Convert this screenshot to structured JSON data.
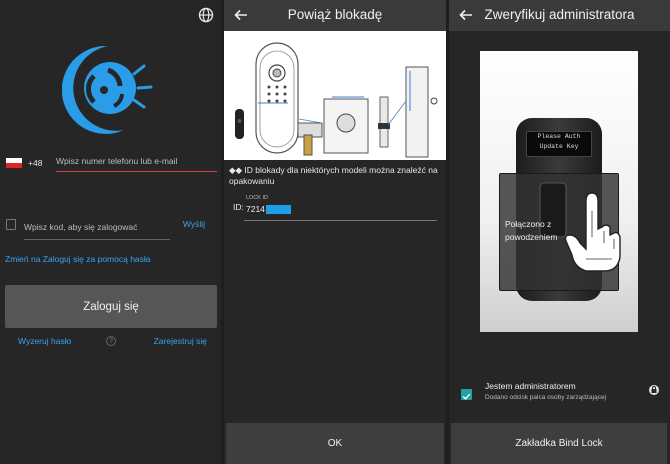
{
  "login": {
    "country_code": "+48",
    "phone_placeholder": "Wpisz numer telefonu lub e-mail",
    "code_placeholder": "Wpisz kod, aby się zalogować",
    "send_label": "Wyślij",
    "switch_label": "Zmień na Zaloguj się za pomocą hasła",
    "login_button": "Zaloguj się",
    "reset_label": "Wyzeruj hasło",
    "register_label": "Zarejestruj się",
    "icons": [
      "globe-icon",
      "app-logo",
      "poland-flag-icon",
      "code-icon",
      "help-icon"
    ]
  },
  "bind": {
    "title": "Powiąż blokadę",
    "hint": "◆◆ ID blokady dla niektórych modeli można znaleźć na opakowaniu",
    "id_prefix": "ID:",
    "lock_id_label": "LOCK ID",
    "lock_id_value": "7214",
    "ok_button": "OK"
  },
  "verify": {
    "title": "Zweryfikuj administratora",
    "screen_line1": "Please Auth",
    "screen_line2": "Update Key",
    "success_text": "Połączono z powodzeniem",
    "admin_label": "Jestem administratorem",
    "admin_sub": "Dodano odcisk palca osoby zarządzającej",
    "bind_button": "Zakładka Bind Lock"
  },
  "colors": {
    "accent": "#3aa3f0",
    "error_line": "#d8433f",
    "checkbox": "#26a0a0",
    "redaction": "#1e9ee8"
  }
}
